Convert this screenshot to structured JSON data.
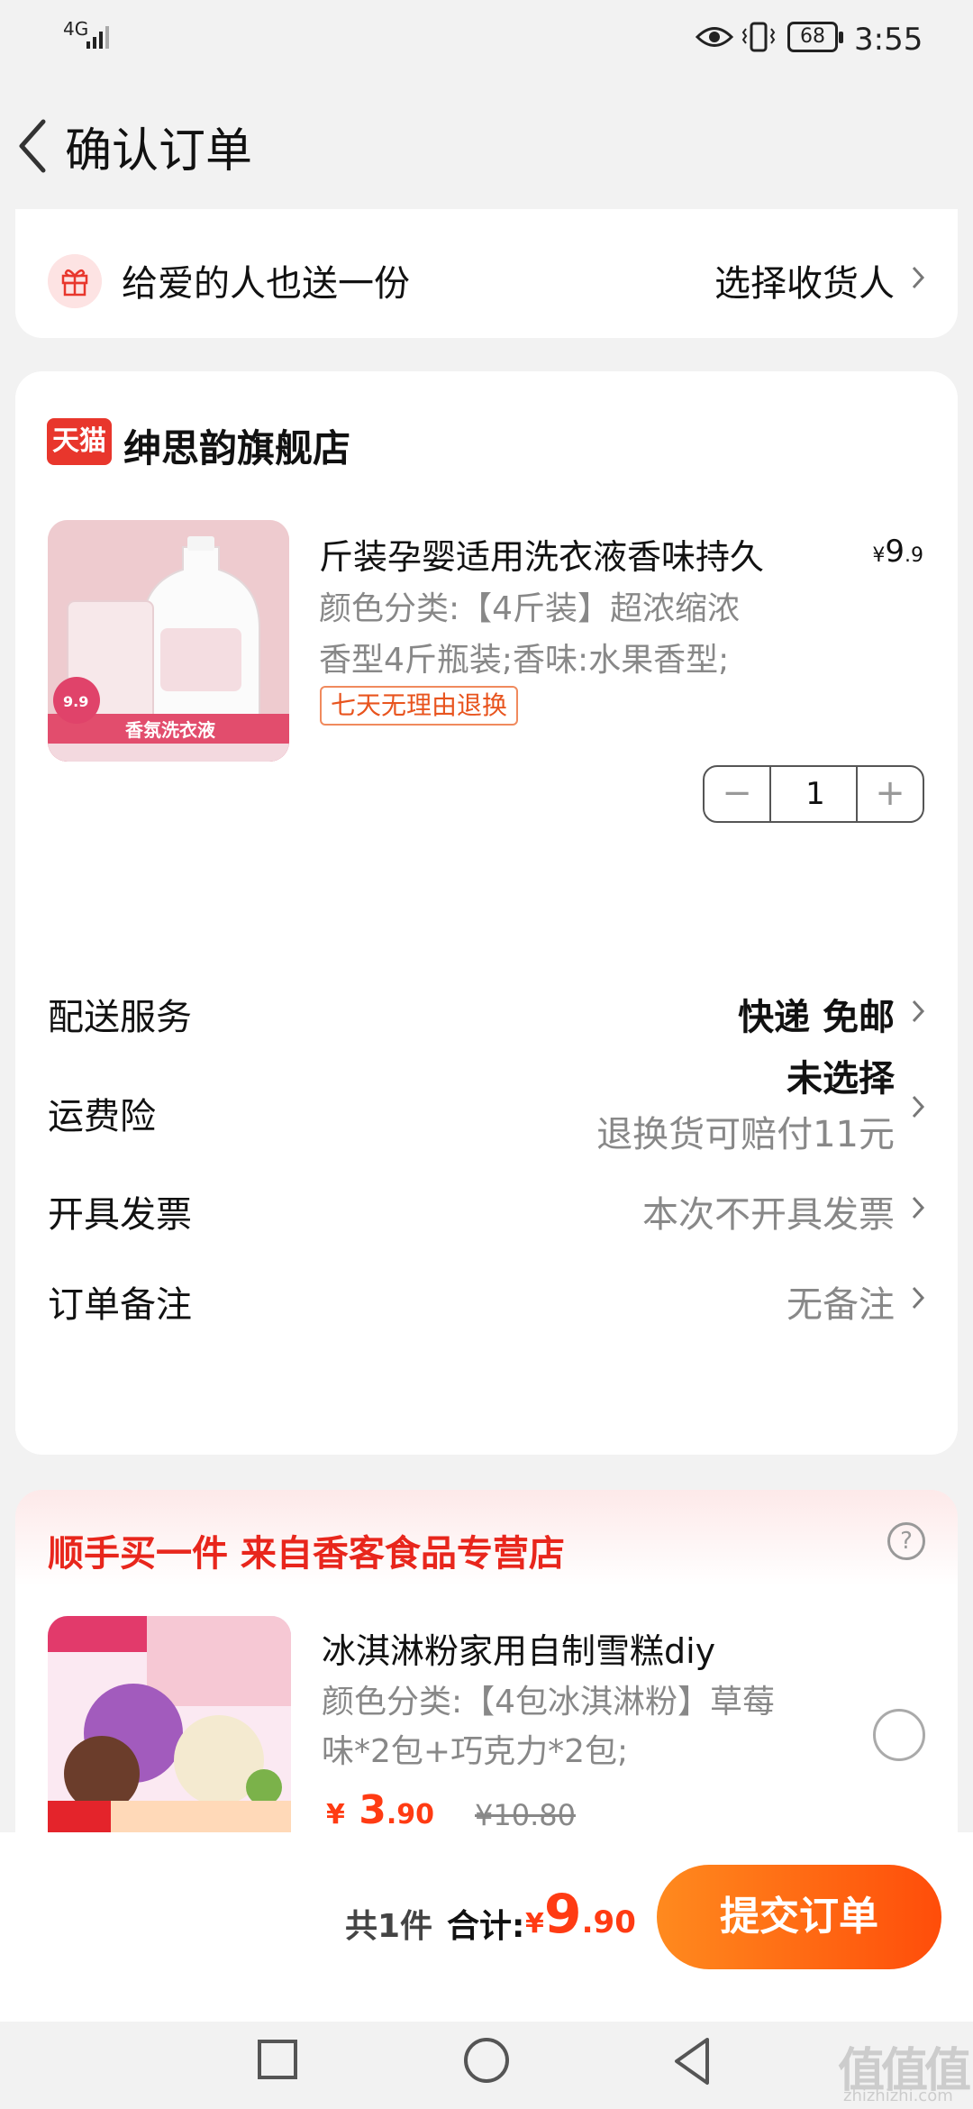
{
  "status_bar": {
    "network": "4G",
    "battery": "68",
    "time": "3:55"
  },
  "header": {
    "title": "确认订单"
  },
  "gift": {
    "label": "给爱的人也送一份",
    "action": "选择收货人"
  },
  "shop": {
    "badge": "天猫",
    "name": "绅思韵旗舰店",
    "product": {
      "title": "斤装孕婴适用洗衣液香味持久",
      "price_symbol": "¥",
      "price_int": "9",
      "price_dec": ".9",
      "spec_line1": "颜色分类:【4斤装】超浓缩浓",
      "spec_line2": "香型4斤瓶装;香味:水果香型;",
      "tag": "七天无理由退换",
      "quantity": "1",
      "minus": "−",
      "plus": "+"
    },
    "rows": {
      "delivery_label": "配送服务",
      "delivery_value": "快递 免邮",
      "insurance_label": "运费险",
      "insurance_value": "未选择",
      "insurance_sub": "退换货可赔付11元",
      "invoice_label": "开具发票",
      "invoice_value": "本次不开具发票",
      "note_label": "订单备注",
      "note_value": "无备注"
    }
  },
  "recommend": {
    "title": "顺手买一件  来自香客食品专营店",
    "help": "?",
    "product": {
      "name": "冰淇淋粉家用自制雪糕diy",
      "spec_line1": "颜色分类:【4包冰淇淋粉】草莓",
      "spec_line2": "味*2包+巧克力*2包;",
      "price_symbol": "¥",
      "price_int": "3",
      "price_dec": ".90",
      "old_price": "¥10.80"
    }
  },
  "footer": {
    "count": "共1件",
    "total_label": "合计:",
    "total_symbol": "¥",
    "total_int": "9",
    "total_dec": ".90",
    "submit": "提交订单"
  },
  "watermark": {
    "logo": "值值值",
    "site": "zhizhizhi.com"
  },
  "colors": {
    "accent": "#ff4d0a",
    "price": "#ff3b13",
    "tmall": "#e8362c"
  }
}
